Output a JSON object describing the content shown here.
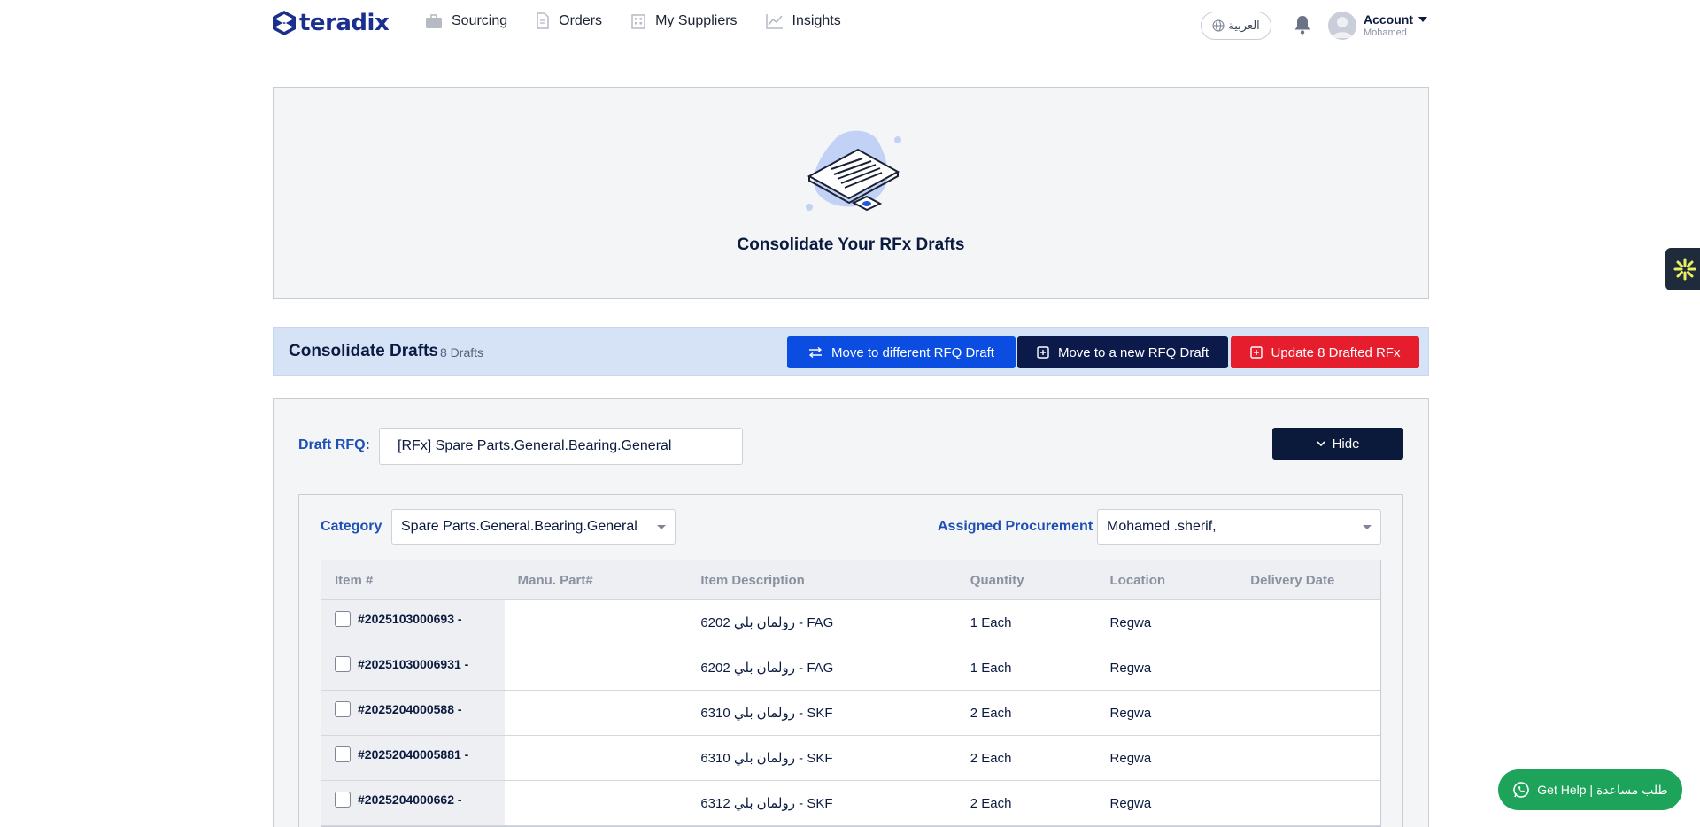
{
  "header": {
    "logo_text": "teradix",
    "nav": [
      {
        "label": "Sourcing",
        "icon": "briefcase-icon"
      },
      {
        "label": "Orders",
        "icon": "document-icon"
      },
      {
        "label": "My Suppliers",
        "icon": "building-icon"
      },
      {
        "label": "Insights",
        "icon": "chart-line-icon"
      }
    ],
    "language": "العربية",
    "account_label": "Account",
    "account_user": "Mohamed"
  },
  "banner": {
    "title": "Consolidate Your RFx Drafts"
  },
  "consolidate": {
    "title": "Consolidate Drafts",
    "count": "8 Drafts",
    "move_different_label": "Move to different RFQ Draft",
    "move_new_label": "Move to a new RFQ Draft",
    "update_label": "Update 8 Drafted RFx"
  },
  "draft": {
    "label": "Draft RFQ:",
    "value": "[RFx] Spare Parts.General.Bearing.General",
    "hide_label": "Hide",
    "category_label": "Category",
    "category_value": "Spare Parts.General.Bearing.General",
    "procurement_label": "Assigned Procurement",
    "procurement_value": "Mohamed .sherif,"
  },
  "table": {
    "columns": [
      "Item #",
      "Manu. Part#",
      "Item Description",
      "Quantity",
      "Location",
      "Delivery Date"
    ],
    "rows": [
      {
        "item": "#2025103000693 -",
        "part": "",
        "desc": "6202 رولمان بلي - FAG",
        "qty": "1 Each",
        "loc": "Regwa",
        "date": ""
      },
      {
        "item": "#20251030006931 -",
        "part": "",
        "desc": "6202 رولمان بلي - FAG",
        "qty": "1 Each",
        "loc": "Regwa",
        "date": ""
      },
      {
        "item": "#2025204000588 -",
        "part": "",
        "desc": "6310 رولمان بلي - SKF",
        "qty": "2 Each",
        "loc": "Regwa",
        "date": ""
      },
      {
        "item": "#20252040005881 -",
        "part": "",
        "desc": "6310 رولمان بلي - SKF",
        "qty": "2 Each",
        "loc": "Regwa",
        "date": ""
      },
      {
        "item": "#2025204000662 -",
        "part": "",
        "desc": "6312 رولمان بلي - SKF",
        "qty": "2 Each",
        "loc": "Regwa",
        "date": ""
      }
    ]
  },
  "help": {
    "label": "Get Help | طلب مساعدة"
  },
  "colors": {
    "brand": "#1b2f8e",
    "primary_blue": "#0a4de0",
    "navy": "#0b1a4a",
    "danger": "#e51d2c",
    "help_green": "#1ea45a"
  }
}
